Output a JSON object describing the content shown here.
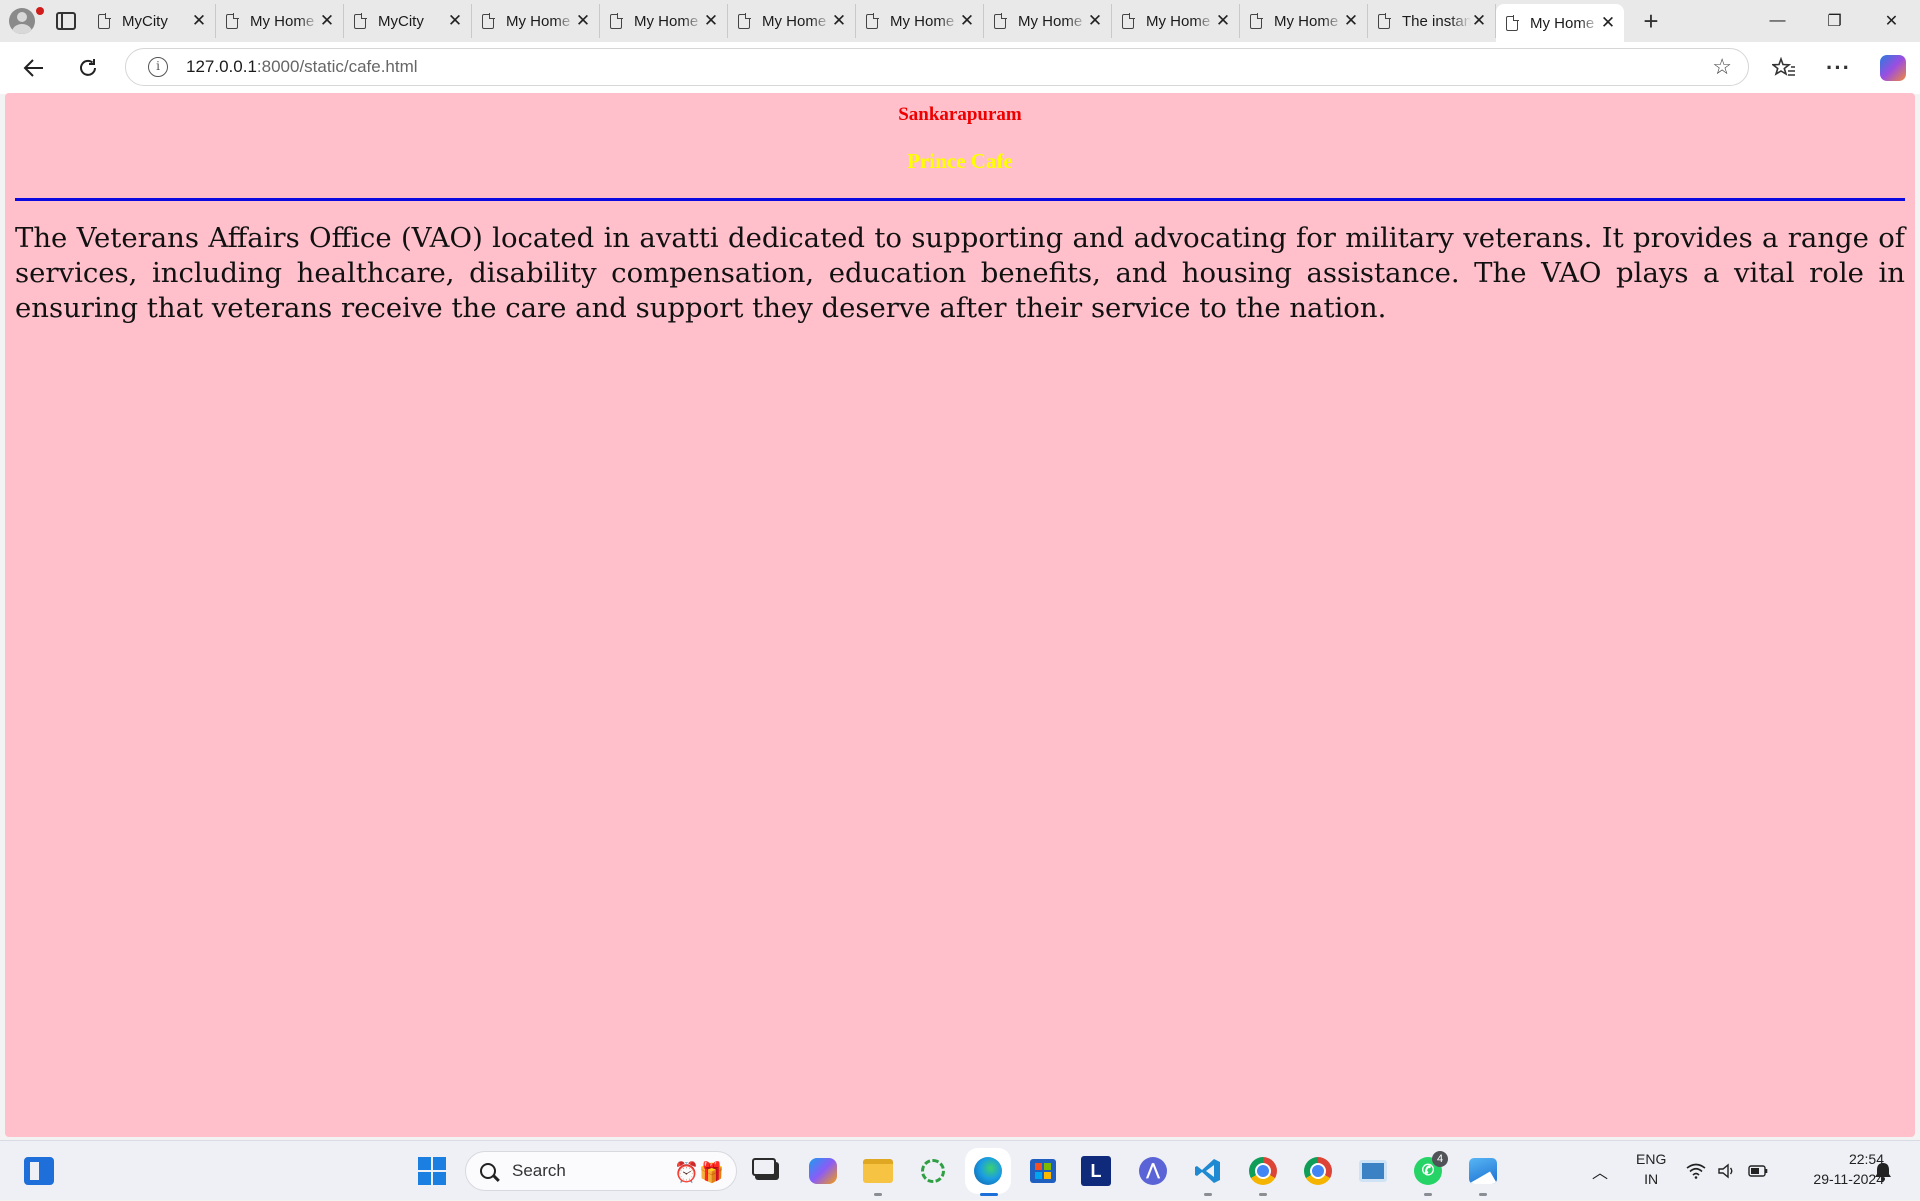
{
  "browser": {
    "tabs": [
      {
        "title": "MyCity"
      },
      {
        "title": "My Home"
      },
      {
        "title": "MyCity"
      },
      {
        "title": "My Home"
      },
      {
        "title": "My Home"
      },
      {
        "title": "My Home"
      },
      {
        "title": "My Home"
      },
      {
        "title": "My Home"
      },
      {
        "title": "My Home"
      },
      {
        "title": "My Home"
      },
      {
        "title": "The instance"
      },
      {
        "title": "My Home",
        "active": true
      }
    ],
    "url_host": "127.0.0.1",
    "url_path": ":8000/static/cafe.html",
    "new_tab_symbol": "+",
    "close_symbol": "✕",
    "window_controls": {
      "minimize": "—",
      "restore": "❐",
      "close": "✕"
    },
    "nav_icons": [
      "back-icon",
      "refresh-icon"
    ],
    "toolbar_icons": [
      "favorites-icon",
      "more-icon",
      "copilot-icon"
    ]
  },
  "page": {
    "city": "Sankarapuram",
    "cafe": "Prince Cafe",
    "description": "The Veterans Affairs Office (VAO) located in avatti dedicated to supporting and advocating for military veterans. It provides a range of services, including healthcare, disability compensation, education benefits, and housing assistance. The VAO plays a vital role in ensuring that veterans receive the care and support they deserve after their service to the nation.",
    "colors": {
      "background": "#ffc0cb",
      "city": "#ee0000",
      "cafe": "#ffff00",
      "rule": "#0a0ae0"
    }
  },
  "taskbar": {
    "search_label": "Search",
    "whatsapp_badge": "4",
    "language": {
      "line1": "ENG",
      "line2": "IN"
    },
    "time": "22:54",
    "date": "29-11-2024"
  }
}
